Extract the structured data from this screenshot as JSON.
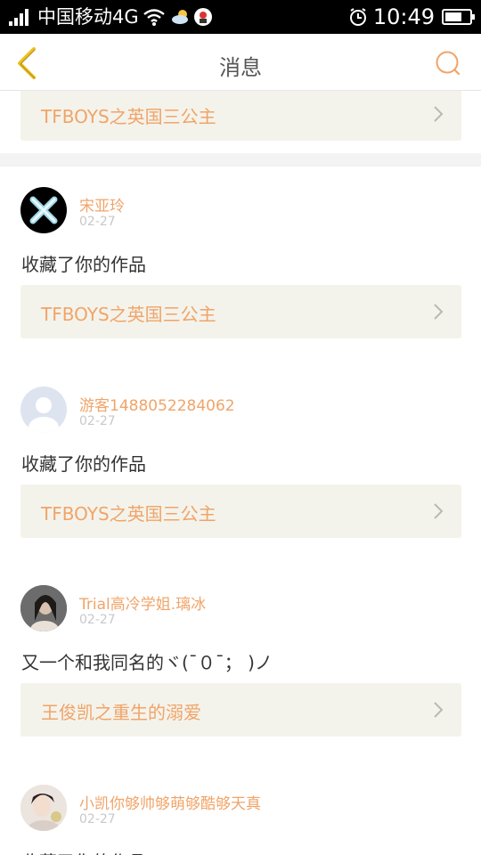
{
  "status_bar": {
    "carrier": "中国移动4G",
    "time": "10:49",
    "battery_level": 0.7,
    "icons": [
      "signal-icon",
      "wifi-icon",
      "weather-icon",
      "app-notification-icon",
      "alarm-icon",
      "battery-icon"
    ]
  },
  "header": {
    "title": "消息",
    "back_icon": "chevron-left-icon",
    "search_icon": "search-icon"
  },
  "colors": {
    "accent": "#f0a469",
    "work_bg": "#f4f3eb",
    "page_bg": "#f3f3f3"
  },
  "feed": {
    "first_partial": {
      "work_title": "TFBOYS之英国三公主"
    },
    "items": [
      {
        "user": "宋亚玲",
        "date": "02-27",
        "message": "收藏了你的作品",
        "work_title": "TFBOYS之英国三公主"
      },
      {
        "user": "游客1488052284062",
        "date": "02-27",
        "message": "收藏了你的作品",
        "work_title": "TFBOYS之英国三公主"
      },
      {
        "user": "Trial高冷学姐.璃冰",
        "date": "02-27",
        "message": "又一个和我同名的ヾ(ˉ０ˉ； )ノ",
        "work_title": "王俊凯之重生的溺爱"
      },
      {
        "user": "小凯你够帅够萌够酷够天真",
        "date": "02-27",
        "message": "收藏了你的作品"
      }
    ]
  }
}
